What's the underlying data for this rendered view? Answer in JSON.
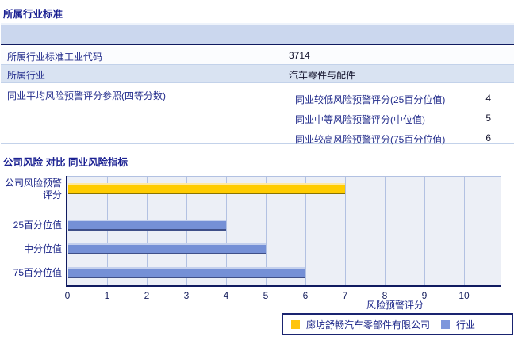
{
  "section1": {
    "title": "所属行业标准",
    "rows": [
      {
        "label": "所属行业标准工业代码",
        "value": "3714"
      },
      {
        "label": "所属行业",
        "value": "汽车零件与配件"
      },
      {
        "label": "同业平均风险预警评分参照(四等分数)",
        "subrows": [
          {
            "label": "同业较低风险预警评分(25百分位值)",
            "value": "4"
          },
          {
            "label": "同业中等风险预警评分(中位值)",
            "value": "5"
          },
          {
            "label": "同业较高风险预警评分(75百分位值)",
            "value": "6"
          }
        ]
      }
    ]
  },
  "section2": {
    "title": "公司风险 对比 同业风险指标"
  },
  "chart_data": {
    "type": "bar",
    "orientation": "horizontal",
    "title": "公司风险 对比 同业风险指标",
    "categories": [
      "公司风险预警评分",
      "25百分位值",
      "中分位值",
      "75百分位值"
    ],
    "bars": [
      {
        "category": "公司风险预警评分",
        "value": 7,
        "series": "company"
      },
      {
        "category": "25百分位值",
        "value": 4,
        "series": "industry"
      },
      {
        "category": "中分位值",
        "value": 5,
        "series": "industry"
      },
      {
        "category": "75百分位值",
        "value": 6,
        "series": "industry"
      }
    ],
    "xlabel": "风险预警评分",
    "xlim": [
      0,
      11
    ],
    "ticks": [
      0,
      1,
      2,
      3,
      4,
      5,
      6,
      7,
      8,
      9,
      10
    ],
    "grid": "vertical",
    "colors": {
      "company": "#FFCC00",
      "industry": "#7590D6"
    },
    "legend": [
      {
        "label": "廊坊舒畅汽车零部件有限公司",
        "series": "company",
        "color": "#FFC40D"
      },
      {
        "label": "行业",
        "series": "industry",
        "color": "#7E97DC"
      }
    ],
    "legend_position": "bottom-right"
  }
}
